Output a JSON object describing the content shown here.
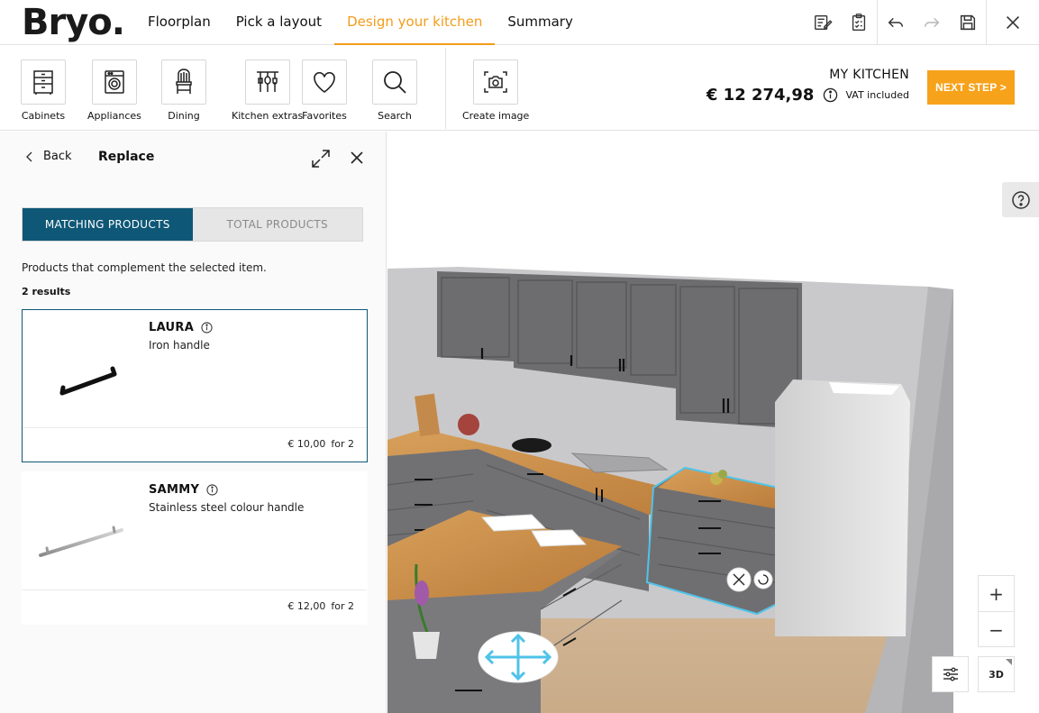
{
  "brand": {
    "logo": "Bryo."
  },
  "nav": {
    "tabs": [
      "Floorplan",
      "Pick a layout",
      "Design your kitchen",
      "Summary"
    ],
    "active": 2
  },
  "toolbar": {
    "tools": [
      {
        "label": "Cabinets",
        "icon": "cabinet-icon"
      },
      {
        "label": "Appliances",
        "icon": "washing-machine-icon"
      },
      {
        "label": "Dining",
        "icon": "chair-icon"
      },
      {
        "label": "Kitchen extras",
        "icon": "utensils-icon"
      },
      {
        "label": "Favorites",
        "icon": "heart-icon"
      },
      {
        "label": "Search",
        "icon": "search-icon"
      },
      {
        "label": "Create image",
        "icon": "camera-icon"
      }
    ]
  },
  "summary": {
    "kitchen_name": "MY KITCHEN",
    "price": "€ 12 274,98",
    "vat": "VAT included"
  },
  "next_step": "NEXT STEP >",
  "panel": {
    "back_label": "Back",
    "title": "Replace",
    "tabs": {
      "matching": "MATCHING PRODUCTS",
      "total": "TOTAL PRODUCTS"
    },
    "description": "Products that complement the selected item.",
    "results": "2 results",
    "products": [
      {
        "name": "LAURA",
        "desc": "Iron handle",
        "price": "€ 10,00",
        "qty": "for 2"
      },
      {
        "name": "SAMMY",
        "desc": "Stainless steel colour handle",
        "price": "€ 12,00",
        "qty": "for 2"
      }
    ]
  },
  "view": {
    "zoom_in": "+",
    "zoom_out": "−",
    "mode": "3D"
  },
  "colors": {
    "accent": "#f39c1a",
    "button": "#f7a21b",
    "teal": "#0f5776",
    "selection": "#4fc3e8"
  }
}
